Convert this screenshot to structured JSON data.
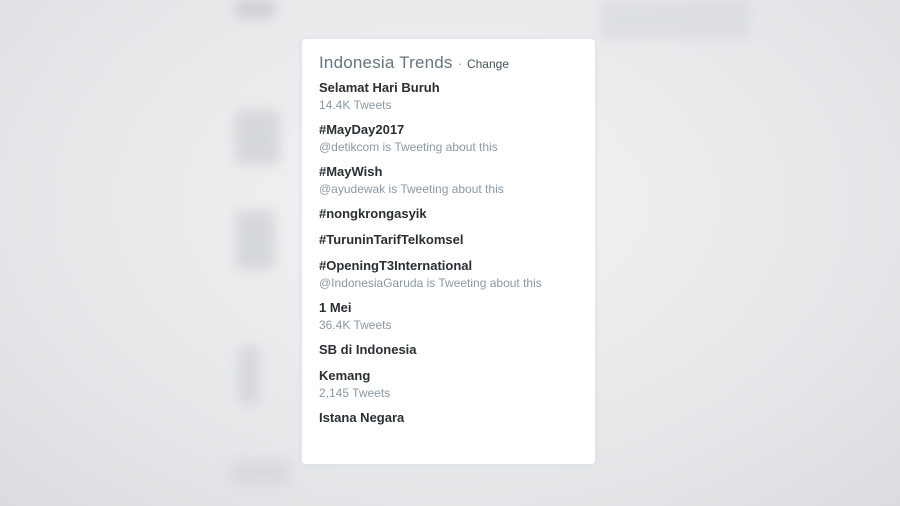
{
  "trends_panel": {
    "title": "Indonesia Trends",
    "separator": "·",
    "change_label": "Change",
    "items": [
      {
        "name": "Selamat Hari Buruh",
        "meta": "14.4K Tweets"
      },
      {
        "name": "#MayDay2017",
        "meta": "@detikcom is Tweeting about this"
      },
      {
        "name": "#MayWish",
        "meta": "@ayudewak is Tweeting about this"
      },
      {
        "name": "#nongkrongasyik",
        "meta": ""
      },
      {
        "name": "#TuruninTarifTelkomsel",
        "meta": ""
      },
      {
        "name": "#OpeningT3International",
        "meta": "@IndonesiaGaruda is Tweeting about this"
      },
      {
        "name": "1 Mei",
        "meta": "36.4K Tweets"
      },
      {
        "name": "SB di Indonesia",
        "meta": ""
      },
      {
        "name": "Kemang",
        "meta": "2,145 Tweets"
      },
      {
        "name": "Istana Negara",
        "meta": ""
      }
    ]
  }
}
